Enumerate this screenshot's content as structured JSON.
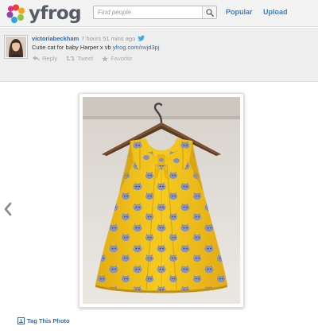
{
  "header": {
    "logo_text": "yfrog",
    "search": {
      "placeholder": "Find people"
    },
    "nav": {
      "popular": "Popular",
      "upload": "Upload"
    }
  },
  "post": {
    "username": "victoriabeckham",
    "time_ago": "7 hours 51 mins ago",
    "caption": "Cutie cat for baby Harper x vb",
    "link": "yfrog.com/nvjd3pj",
    "actions": {
      "reply": "Reply",
      "tweet": "Tweet",
      "favorite": "Favorite"
    }
  },
  "photo": {
    "tag_label": "Tag This Photo"
  },
  "colors": {
    "brand_blue": "#3a7fc9",
    "link_blue": "#2d6bb3",
    "dress_yellow": "#f3c31a",
    "cat_blue": "#7f8fc6"
  },
  "icons": [
    "logo-flower-icon",
    "search-icon",
    "twitter-bird-icon",
    "reply-icon",
    "retweet-icon",
    "star-icon",
    "chevron-left-icon",
    "tag-icon"
  ]
}
